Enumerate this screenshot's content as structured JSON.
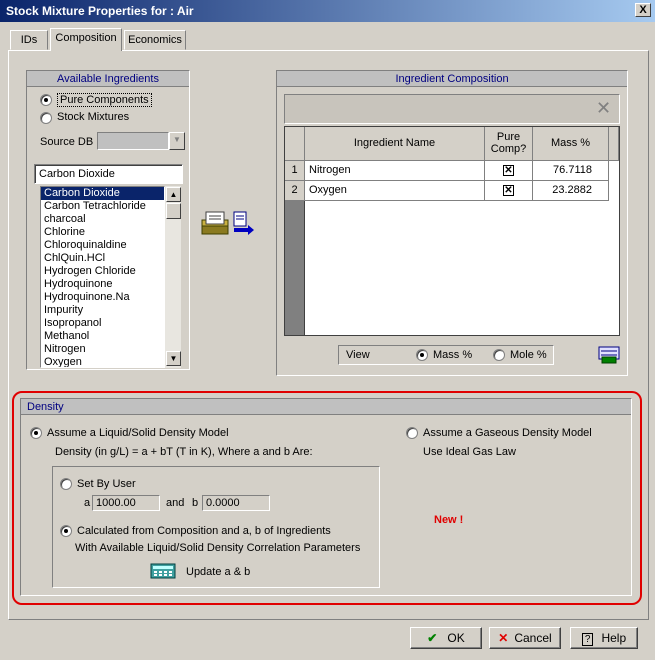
{
  "window": {
    "title": "Stock Mixture Properties for : Air",
    "close": "X"
  },
  "tabs": [
    {
      "label": "IDs"
    },
    {
      "label": "Composition"
    },
    {
      "label": "Economics"
    }
  ],
  "available": {
    "title": "Available Ingredients",
    "opt_pure": "Pure Components",
    "opt_stock": "Stock Mixtures",
    "source_label": "Source DB",
    "search_value": "Carbon Dioxide",
    "items": [
      "Carbon Dioxide",
      "Carbon Tetrachloride",
      "charcoal",
      "Chlorine",
      "Chloroquinaldine",
      "ChlQuin.HCl",
      "Hydrogen Chloride",
      "Hydroquinone",
      "Hydroquinone.Na",
      "Impurity",
      "Isopropanol",
      "Methanol",
      "Nitrogen",
      "Oxygen"
    ]
  },
  "composition": {
    "title": "Ingredient Composition",
    "delete": "✕",
    "col_name": "Ingredient Name",
    "col_pure_1": "Pure",
    "col_pure_2": "Comp?",
    "col_mass": "Mass %",
    "rows": [
      {
        "num": "1",
        "name": "Nitrogen",
        "pure": "✕",
        "mass": "76.7118"
      },
      {
        "num": "2",
        "name": "Oxygen",
        "pure": "✕",
        "mass": "23.2882"
      }
    ],
    "view_label": "View",
    "view_mass": "Mass %",
    "view_mole": "Mole %"
  },
  "density": {
    "title": "Density",
    "opt_liquid": "Assume a Liquid/Solid Density Model",
    "formula": "Density (in g/L) = a + bT (T in K), Where a and b Are:",
    "opt_user": "Set By User",
    "a_label": "a",
    "a_value": "1000.00",
    "and_label": "and",
    "b_label": "b",
    "b_value": "0.0000",
    "opt_calc": "Calculated from Composition and a, b of Ingredients",
    "calc_sub": "With Available Liquid/Solid Density Correlation Parameters",
    "update_label": "Update a & b",
    "opt_gas": "Assume a Gaseous Density Model",
    "gas_sub": "Use Ideal Gas Law",
    "new_badge": "New !"
  },
  "buttons": {
    "ok": "OK",
    "cancel": "Cancel",
    "help": "Help"
  }
}
